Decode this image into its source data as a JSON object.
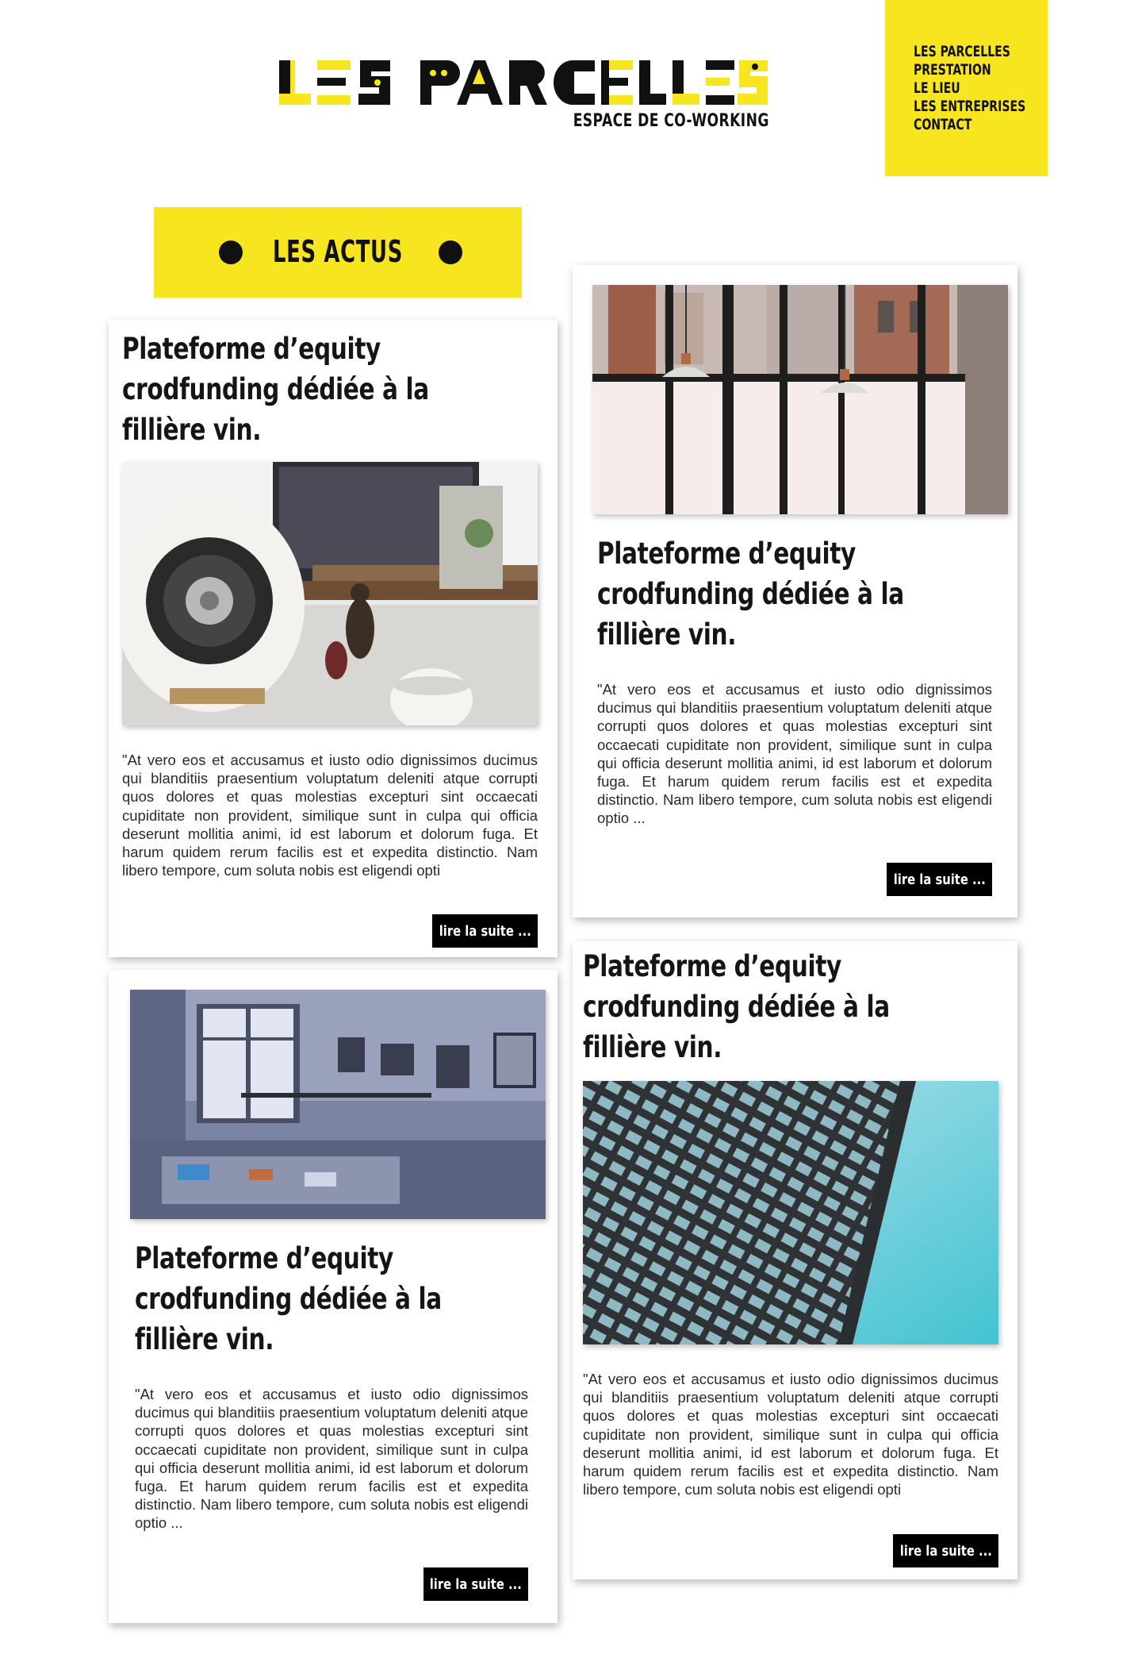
{
  "brand": {
    "name": "LES PARCELLES",
    "tagline": "ESPACE DE CO-WORKING",
    "colors": {
      "accent": "#f7e51f",
      "ink": "#111111",
      "button": "#000000"
    }
  },
  "nav": {
    "items": [
      {
        "label": "LES PARCELLES"
      },
      {
        "label": "PRESTATION"
      },
      {
        "label": "LE LIEU"
      },
      {
        "label": "LES ENTREPRISES"
      },
      {
        "label": "CONTACT"
      }
    ]
  },
  "section": {
    "title": "LES ACTUS"
  },
  "cards": [
    {
      "title_lines": [
        "Plateforme d’equity",
        "crodfunding dédiée à la",
        "fillière vin."
      ],
      "image": "desk-speaker-photo",
      "text": "\"At vero eos et accusamus et iusto odio dignissimos ducimus qui blanditiis praesentium voluptatum deleniti atque corrupti quos dolores et quas molestias excepturi sint occaecati cupiditate non provident, similique sunt in culpa qui officia deserunt mollitia animi, id est laborum et dolorum fuga. Et harum quidem rerum facilis est et expedita distinctio. Nam libero tempore, cum soluta nobis est eligendi opti",
      "button": "lire la suite ..."
    },
    {
      "title_lines": [
        "Plateforme d’equity",
        "crodfunding dédiée à la",
        "fillière vin."
      ],
      "image": "window-lamps-photo",
      "text": "\"At vero eos et accusamus et iusto odio dignissimos ducimus qui blanditiis praesentium voluptatum deleniti atque corrupti quos dolores et quas molestias excepturi sint occaecati cupiditate non provident, similique sunt in culpa qui officia deserunt mollitia animi, id est laborum et dolorum fuga. Et harum quidem rerum facilis est et expedita distinctio. Nam libero tempore, cum soluta nobis est eligendi optio ...",
      "button": "lire la suite ..."
    },
    {
      "title_lines": [
        "Plateforme d’equity",
        "crodfunding dédiée à la",
        "fillière vin."
      ],
      "image": "office-room-photo",
      "text": "\"At vero eos et accusamus et iusto odio dignissimos ducimus qui blanditiis praesentium voluptatum deleniti atque corrupti quos dolores et quas molestias excepturi sint occaecati cupiditate non provident, similique sunt in culpa qui officia deserunt mollitia animi, id est laborum et dolorum fuga. Et harum quidem rerum facilis est et expedita distinctio. Nam libero tempore, cum soluta nobis est eligendi optio ...",
      "button": "lire la suite ..."
    },
    {
      "title_lines": [
        "Plateforme d’equity",
        "crodfunding dédiée à la",
        "fillière vin."
      ],
      "image": "skyscraper-photo",
      "text": "\"At vero eos et accusamus et iusto odio dignissimos ducimus qui blanditiis praesentium voluptatum deleniti atque corrupti quos dolores et quas molestias excepturi sint occaecati cupiditate non provident, similique sunt in culpa qui officia deserunt mollitia animi, id est laborum et dolorum fuga. Et harum quidem rerum facilis est et expedita distinctio. Nam libero tempore, cum soluta nobis est eligendi opti",
      "button": "lire la suite ..."
    }
  ]
}
